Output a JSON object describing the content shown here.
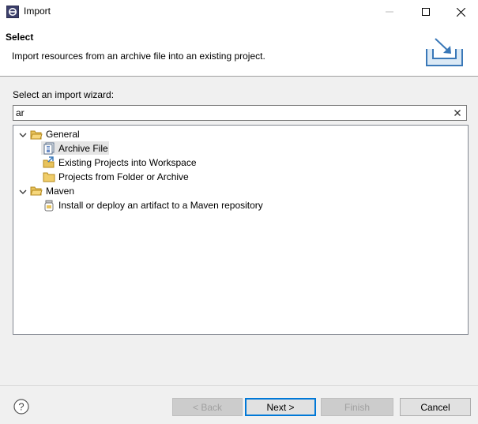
{
  "window": {
    "title": "Import",
    "icon": "eclipse-icon"
  },
  "header": {
    "title": "Select",
    "description": "Import resources from an archive file into an existing project."
  },
  "wizard": {
    "select_label": "Select an import wizard:",
    "filter_value": "ar",
    "tree": [
      {
        "label": "General",
        "expanded": true,
        "icon": "folder-open-icon",
        "children": [
          {
            "label": "Archive File",
            "icon": "archive-file-icon",
            "selected": true
          },
          {
            "label": "Existing Projects into Workspace",
            "icon": "existing-projects-icon"
          },
          {
            "label": "Projects from Folder or Archive",
            "icon": "folder-icon"
          }
        ]
      },
      {
        "label": "Maven",
        "expanded": true,
        "icon": "folder-open-icon",
        "children": [
          {
            "label": "Install or deploy an artifact to a Maven repository",
            "icon": "maven-jar-icon"
          }
        ]
      }
    ]
  },
  "buttons": {
    "back": "< Back",
    "next": "Next >",
    "finish": "Finish",
    "cancel": "Cancel"
  },
  "colors": {
    "selection": "#e5e5e5",
    "default_button_border": "#0078d7",
    "header_background": "#ffffff",
    "dialog_background": "#f0f0f0"
  }
}
